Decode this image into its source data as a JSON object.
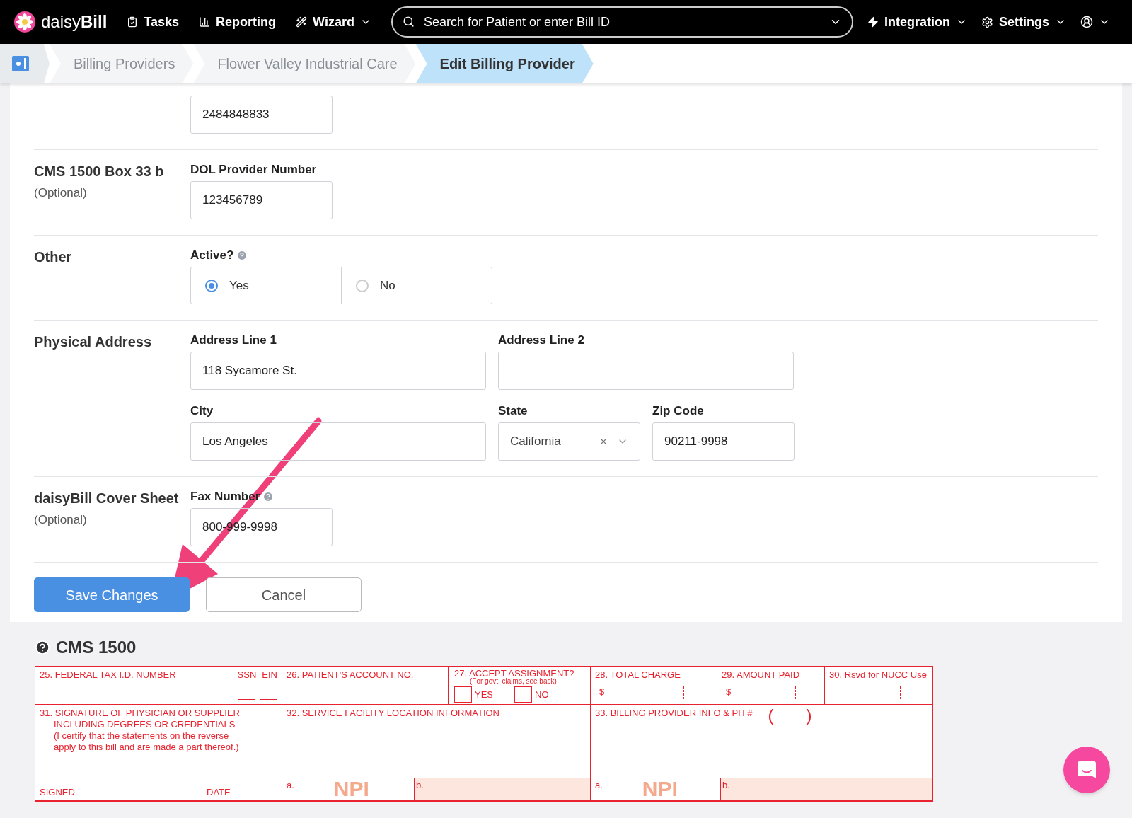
{
  "topbar": {
    "logo": "daisy**Bill**",
    "nav": [
      {
        "kind": "tasks",
        "label": "Tasks",
        "dropdown": false
      },
      {
        "kind": "reporting",
        "label": "Reporting",
        "dropdown": false
      },
      {
        "kind": "wizard",
        "label": "Wizard",
        "dropdown": true
      }
    ],
    "search": {
      "placeholder": "Search for Patient or enter Bill ID"
    },
    "right_nav": [
      {
        "kind": "integration",
        "label": "Integration"
      },
      {
        "kind": "settings",
        "label": "Settings"
      },
      {
        "kind": "account"
      }
    ]
  },
  "breadcrumbs": [
    {
      "label": "Billing Providers",
      "selected": false
    },
    {
      "label": "Flower Valley Industrial Care",
      "selected": false
    },
    {
      "label": "Edit Billing Provider",
      "selected": true
    }
  ],
  "sections": [
    {
      "fields": [
        {
          "kind": "text",
          "value": "2484848833"
        }
      ]
    },
    {
      "title": "CMS 1500 Box 33 b",
      "note": "(Optional)",
      "fields": [
        {
          "kind": "text",
          "label": "DOL Provider Number",
          "value": "123456789"
        }
      ]
    },
    {
      "title": "Other",
      "fields": [
        {
          "kind": "radio",
          "label": "Active?",
          "help": true,
          "options": [
            {
              "label": "Yes",
              "selected": true
            },
            {
              "label": "No",
              "selected": false
            }
          ]
        }
      ]
    },
    {
      "title": "Physical Address",
      "rows": [
        [
          {
            "kind": "text",
            "label": "Address Line 1",
            "value": "118 Sycamore St.",
            "wide": true
          },
          {
            "kind": "text",
            "label": "Address Line 2",
            "wide": true
          }
        ],
        [
          {
            "kind": "text",
            "label": "City",
            "value": "Los Angeles",
            "wide": true
          },
          {
            "kind": "select",
            "label": "State",
            "value": "California"
          },
          {
            "kind": "text",
            "label": "Zip Code",
            "value": "90211-9998"
          }
        ]
      ]
    },
    {
      "title": "daisyBill Cover Sheet",
      "note": "(Optional)",
      "fields": [
        {
          "kind": "text",
          "label": "Fax Number",
          "help": true,
          "value": "800-999-9998"
        }
      ]
    }
  ],
  "buttons": [
    {
      "kind": "primary",
      "label": "Save Changes"
    },
    {
      "kind": "secondary",
      "label": "Cancel"
    }
  ],
  "preview": {
    "title": "CMS 1500",
    "box25": {
      "label": "25. FEDERAL TAX I.D. NUMBER",
      "ssn": "SSN",
      "ein": "EIN",
      "ssn_checked": false,
      "ein_checked": false
    },
    "box26": "26. PATIENT'S ACCOUNT NO.",
    "box27": {
      "label": "27. ACCEPT ASSIGNMENT?",
      "sub": "(For govt. claims, see back)",
      "yes": "YES",
      "no": "NO",
      "yes_checked": false,
      "no_checked": false
    },
    "box28": {
      "label": "28. TOTAL CHARGE",
      "currency": "$"
    },
    "box29": {
      "label": "29. AMOUNT PAID",
      "currency": "$"
    },
    "box30": "30. Rsvd for NUCC Use",
    "box31": {
      "lines": [
        "31. SIGNATURE OF PHYSICIAN OR SUPPLIER",
        "INCLUDING DEGREES OR CREDENTIALS",
        "(I certify that the statements on the reverse",
        "apply to this bill and are made a part thereof.)"
      ],
      "signed": "SIGNED",
      "date": "DATE"
    },
    "box32": {
      "label": "32. SERVICE FACILITY LOCATION INFORMATION",
      "a": "a.",
      "npi": "NPI",
      "b": "b."
    },
    "box33": {
      "label": "33. BILLING PROVIDER INFO & PH #",
      "open": "(",
      "close": ")",
      "a": "a.",
      "npi": "NPI",
      "b": "b."
    }
  }
}
